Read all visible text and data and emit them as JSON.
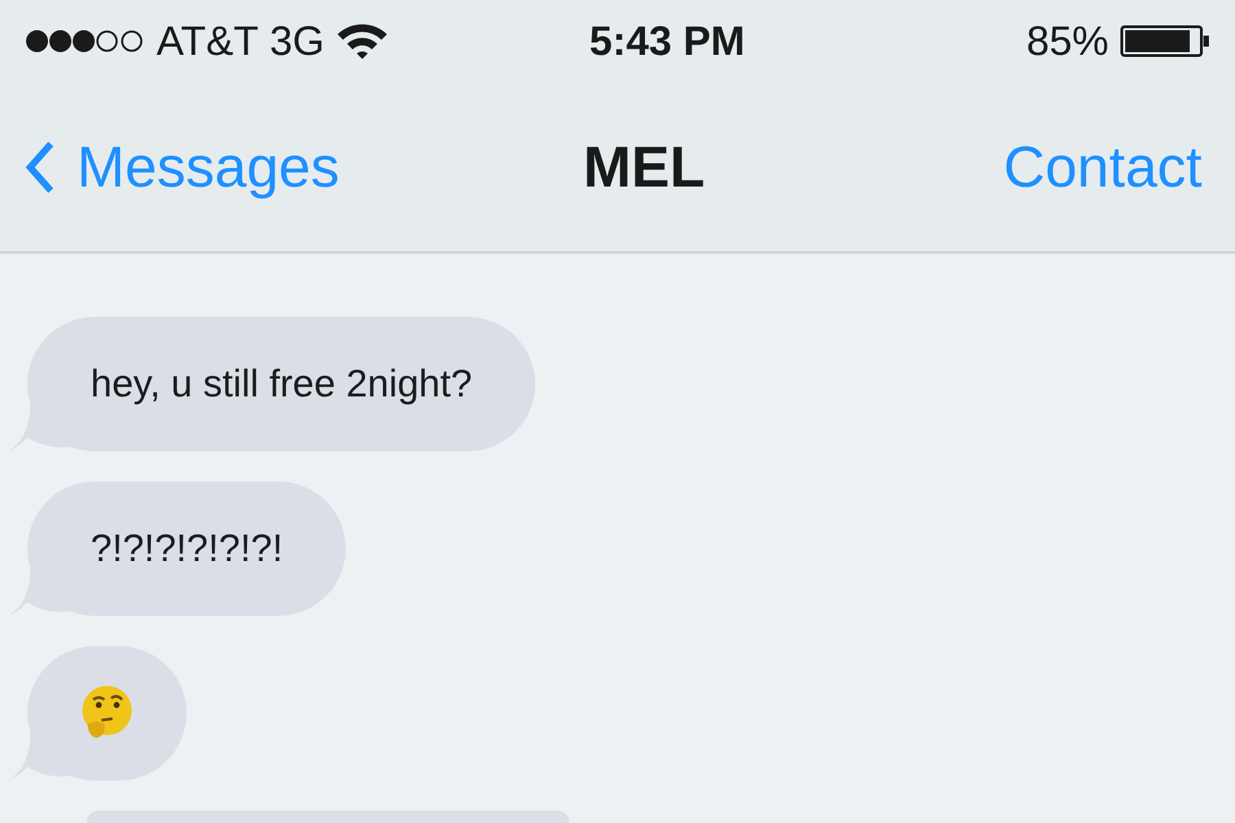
{
  "status_bar": {
    "carrier": "AT&T",
    "network": "3G",
    "time": "5:43 PM",
    "battery": "85%"
  },
  "nav_bar": {
    "back": "Messages",
    "title": "MEL",
    "action": "Contact"
  },
  "messages": [
    {
      "kind": "text",
      "text": "hey, u still free 2night?"
    },
    {
      "kind": "text",
      "text": "?!?!?!?!?!?!"
    },
    {
      "kind": "emoji"
    },
    {
      "kind": "partial"
    }
  ]
}
